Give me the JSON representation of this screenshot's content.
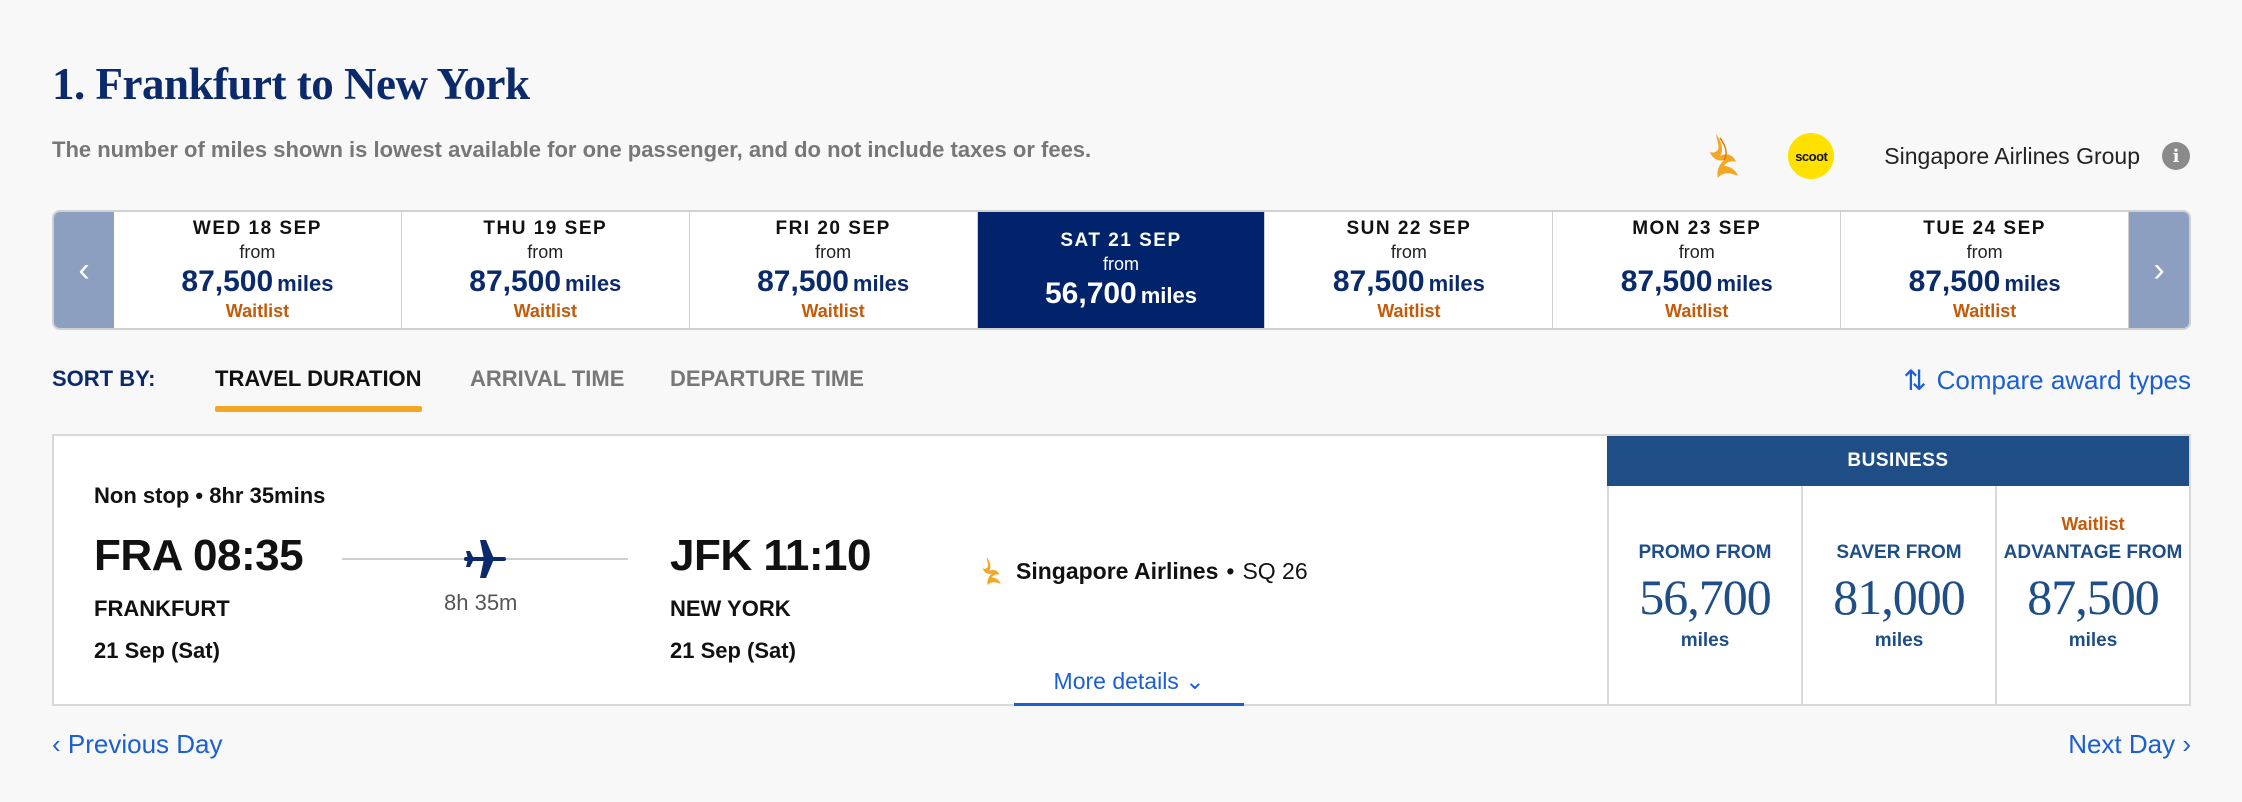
{
  "header": {
    "title": "1. Frankfurt to New York",
    "subtitle": "The number of miles shown is lowest available for one passenger, and do not include taxes or fees.",
    "airline_group_label": "Singapore Airlines Group",
    "scoot_logo_text": "scoot",
    "info_icon": "i"
  },
  "date_nav": {
    "prev_arrow": "‹",
    "next_arrow": "›",
    "dates": [
      {
        "day": "WED 18 SEP",
        "from": "from",
        "miles": "87,500",
        "unit": "miles",
        "status": "Waitlist",
        "selected": false
      },
      {
        "day": "THU 19 SEP",
        "from": "from",
        "miles": "87,500",
        "unit": "miles",
        "status": "Waitlist",
        "selected": false
      },
      {
        "day": "FRI 20 SEP",
        "from": "from",
        "miles": "87,500",
        "unit": "miles",
        "status": "Waitlist",
        "selected": false
      },
      {
        "day": "SAT 21 SEP",
        "from": "from",
        "miles": "56,700",
        "unit": "miles",
        "status": "",
        "selected": true
      },
      {
        "day": "SUN 22 SEP",
        "from": "from",
        "miles": "87,500",
        "unit": "miles",
        "status": "Waitlist",
        "selected": false
      },
      {
        "day": "MON 23 SEP",
        "from": "from",
        "miles": "87,500",
        "unit": "miles",
        "status": "Waitlist",
        "selected": false
      },
      {
        "day": "TUE 24 SEP",
        "from": "from",
        "miles": "87,500",
        "unit": "miles",
        "status": "Waitlist",
        "selected": false
      }
    ]
  },
  "sort": {
    "label": "SORT BY:",
    "tabs": [
      "TRAVEL DURATION",
      "ARRIVAL TIME",
      "DEPARTURE TIME"
    ],
    "active_tab": "TRAVEL DURATION",
    "compare_label": "Compare award types",
    "compare_icon": "⇅"
  },
  "flight": {
    "stop_info": "Non stop • 8hr 35mins",
    "departure": {
      "code_time": "FRA 08:35",
      "city": "FRANKFURT",
      "date": "21 Sep (Sat)"
    },
    "arrival": {
      "code_time": "JFK 11:10",
      "city": "NEW YORK",
      "date": "21 Sep (Sat)"
    },
    "duration": "8h 35m",
    "carrier_name": "Singapore Airlines",
    "separator": "•",
    "flight_number": "SQ 26",
    "more_details": "More details ⌄"
  },
  "fares": {
    "cabin": "BUSINESS",
    "columns": [
      {
        "waitlist": "",
        "label": "PROMO FROM",
        "value": "56,700",
        "unit": "miles"
      },
      {
        "waitlist": "",
        "label": "SAVER FROM",
        "value": "81,000",
        "unit": "miles"
      },
      {
        "waitlist": "Waitlist",
        "label": "ADVANTAGE FROM",
        "value": "87,500",
        "unit": "miles"
      }
    ]
  },
  "footer": {
    "prev_day": "‹ Previous Day",
    "next_day": "Next Day ›"
  },
  "colors": {
    "brand_navy": "#0b2a6b",
    "selected_bg": "#00236b",
    "link_blue": "#1b5fd1",
    "waitlist_orange": "#c35b0b",
    "accent_underline": "#f5a623",
    "fare_header": "#1f4e87"
  }
}
